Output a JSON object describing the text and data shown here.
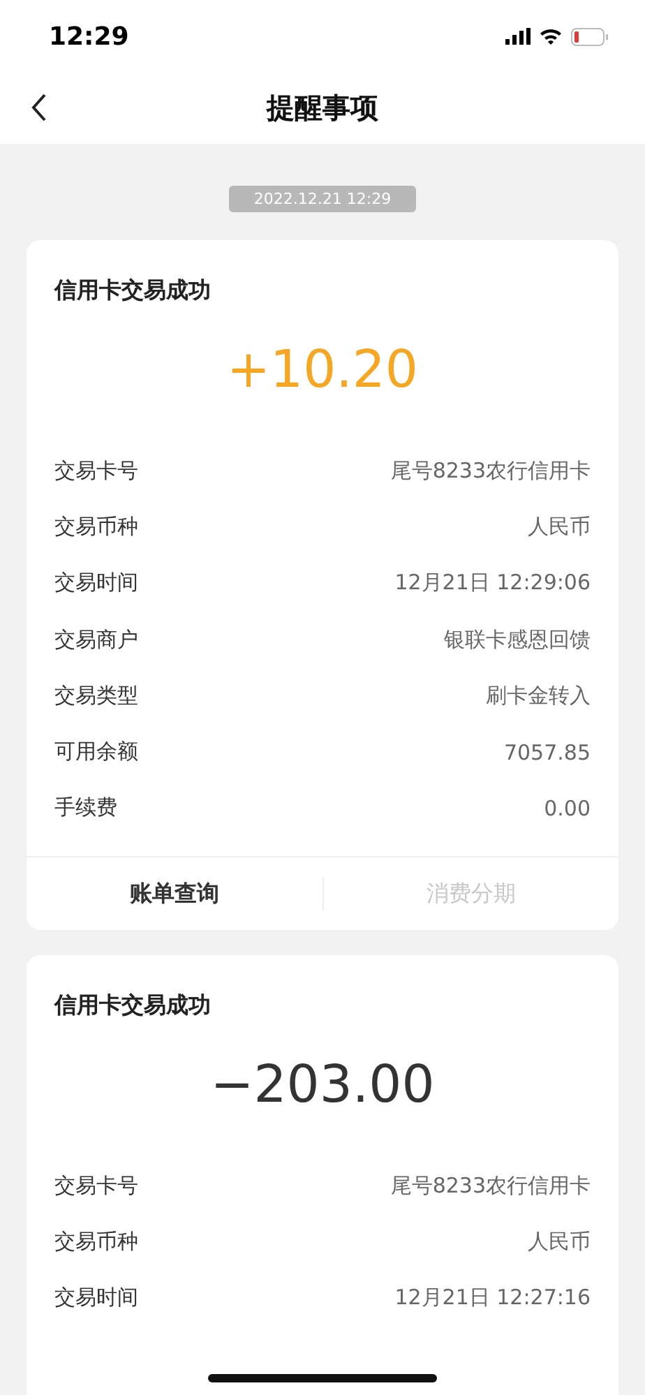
{
  "status_bar": {
    "time": "12:29"
  },
  "nav": {
    "title": "提醒事项"
  },
  "date_badge": "2022.12.21 12:29",
  "cards": [
    {
      "title": "信用卡交易成功",
      "amount": "+10.20",
      "kind": "credit",
      "rows": [
        {
          "label": "交易卡号",
          "value": "尾号8233农行信用卡"
        },
        {
          "label": "交易币种",
          "value": "人民币"
        },
        {
          "label": "交易时间",
          "value": "12月21日 12:29:06"
        },
        {
          "label": "交易商户",
          "value": "银联卡感恩回馈"
        },
        {
          "label": "交易类型",
          "value": "刷卡金转入"
        },
        {
          "label": "可用余额",
          "value": "7057.85"
        },
        {
          "label": "手续费",
          "value": "0.00"
        }
      ],
      "actions": [
        {
          "label": "账单查询",
          "disabled": false
        },
        {
          "label": "消费分期",
          "disabled": true
        }
      ]
    },
    {
      "title": "信用卡交易成功",
      "amount": "−203.00",
      "kind": "debit",
      "rows": [
        {
          "label": "交易卡号",
          "value": "尾号8233农行信用卡"
        },
        {
          "label": "交易币种",
          "value": "人民币"
        },
        {
          "label": "交易时间",
          "value": "12月21日 12:27:16"
        }
      ]
    }
  ]
}
